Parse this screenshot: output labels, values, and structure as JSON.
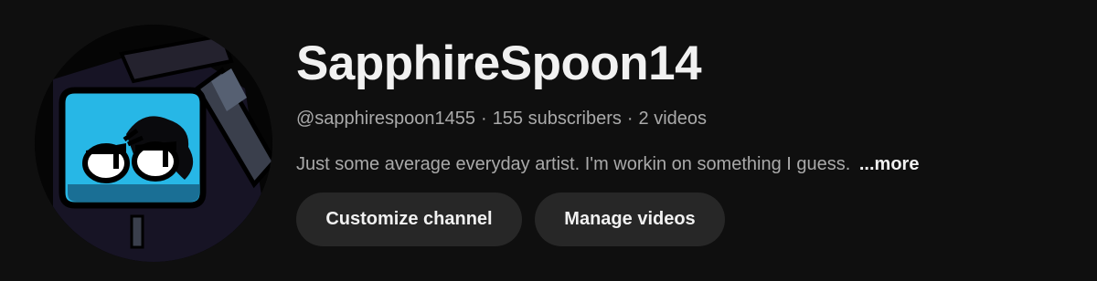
{
  "channel": {
    "name": "SapphireSpoon14",
    "handle": "@sapphirespoon1455",
    "separator": "·",
    "subscribers": "155 subscribers",
    "videos": "2 videos",
    "description": "Just some average everyday artist. I'm workin on something I guess.",
    "more_label": "...more"
  },
  "buttons": {
    "customize_label": "Customize channel",
    "manage_label": "Manage videos"
  },
  "avatar": {
    "icon": "character-avatar",
    "colors": {
      "background": "#050505",
      "screen": "#27b7e6",
      "screen_dark": "#1a6f95",
      "body": "#171425",
      "outline": "#000000",
      "eye": "#ffffff"
    }
  },
  "theme": {
    "background": "#0f0f0f",
    "text_primary": "#f1f1f1",
    "text_secondary": "#aaaaaa",
    "button_bg": "#272727"
  }
}
